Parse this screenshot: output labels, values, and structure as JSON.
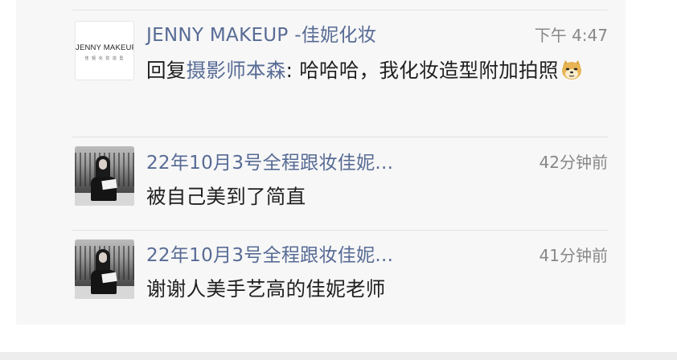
{
  "comments": [
    {
      "author": "JENNY MAKEUP -佳妮化妆",
      "time": "下午 4:47",
      "reply_prefix": "回复",
      "reply_to": "摄影师本森",
      "text": ": 哈哈哈，我化妆造型附加拍照",
      "emoji": "doge-emoji",
      "avatar": {
        "type": "logo",
        "logo_text": "JENNY MAKEUP",
        "logo_sub": "佳 妮 化 妆 造 型"
      }
    },
    {
      "author": "22年10月3号全程跟妆佳妮...",
      "time": "42分钟前",
      "text": "被自己美到了简直",
      "avatar": {
        "type": "photo"
      }
    },
    {
      "author": "22年10月3号全程跟妆佳妮...",
      "time": "41分钟前",
      "text": "谢谢人美手艺高的佳妮老师",
      "avatar": {
        "type": "photo"
      }
    }
  ],
  "colors": {
    "link": "#576b95",
    "text": "#1f1f1f",
    "time": "#888888",
    "background": "#f7f7f7"
  }
}
